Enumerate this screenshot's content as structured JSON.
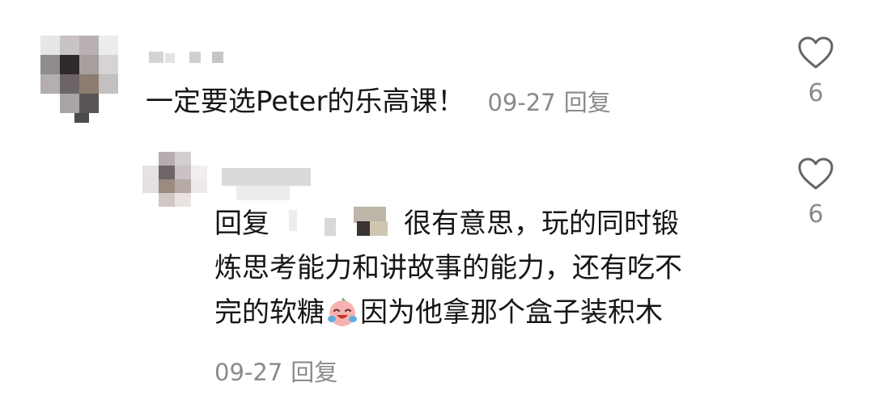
{
  "comment": {
    "text": "一定要选Peter的乐高课！",
    "date": "09-27",
    "reply_label": "回复",
    "like_count": "6"
  },
  "reply": {
    "prefix": "回复",
    "line1": "很有意思，玩的同时锻",
    "line2": "炼思考能力和讲故事的能力，还有吃不",
    "line3_before": "完的软糖",
    "line3_after": "因为他拿那个盒子装积木",
    "date": "09-27",
    "reply_label": "回复",
    "like_count": "6"
  },
  "icons": {
    "like": "heart-outline-icon",
    "emoji": "crying-laughing-emoji-icon"
  },
  "colors": {
    "text": "#161616",
    "meta": "#8a8a8a",
    "icon": "#666666"
  }
}
